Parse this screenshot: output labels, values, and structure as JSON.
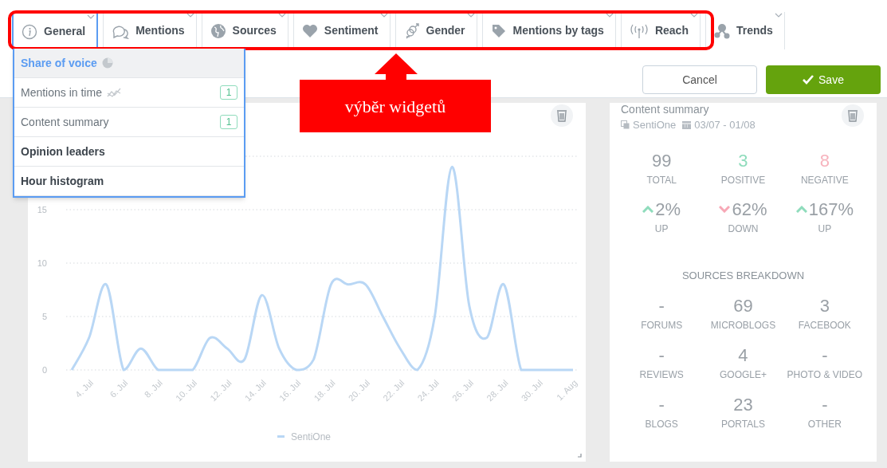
{
  "tabs": [
    {
      "label": "General",
      "kind": "info",
      "selected": true
    },
    {
      "label": "Mentions",
      "kind": "chat",
      "selected": false
    },
    {
      "label": "Sources",
      "kind": "globe",
      "selected": false
    },
    {
      "label": "Sentiment",
      "kind": "heart",
      "selected": false
    },
    {
      "label": "Gender",
      "kind": "gender",
      "selected": false
    },
    {
      "label": "Mentions by tags",
      "kind": "tag",
      "selected": false
    },
    {
      "label": "Reach",
      "kind": "antenna",
      "selected": false
    },
    {
      "label": "Trends",
      "kind": "people",
      "selected": false
    }
  ],
  "dropdown": {
    "items": [
      {
        "label": "Share of voice",
        "kind": "pie",
        "selected": true,
        "used": false
      },
      {
        "label": "Mentions in time",
        "kind": "line",
        "count": "1",
        "selected": false,
        "used": true
      },
      {
        "label": "Content summary",
        "count": "1",
        "selected": false,
        "used": true
      },
      {
        "label": "Opinion leaders",
        "selected": false,
        "used": false
      },
      {
        "label": "Hour histogram",
        "selected": false,
        "used": false
      }
    ]
  },
  "buttons": {
    "cancel": "Cancel",
    "save": "Save"
  },
  "annotation": {
    "text": "výběr widgetů"
  },
  "chart_widget": {
    "chart_data": {
      "type": "line",
      "categories": [
        null,
        "4. Jul",
        null,
        "6. Jul",
        null,
        "8. Jul",
        null,
        "10. Jul",
        null,
        "12. Jul",
        null,
        "14. Jul",
        null,
        "16. Jul",
        null,
        "18. Jul",
        null,
        "20. Jul",
        null,
        "22. Jul",
        null,
        "24. Jul",
        null,
        "26. Jul",
        null,
        "28. Jul",
        null,
        "30. Jul",
        null,
        "1. Aug"
      ],
      "ylim": [
        0,
        20
      ],
      "grid": true,
      "yticks": [
        0,
        5,
        10,
        15
      ],
      "series": [
        {
          "name": "SentiOne",
          "color": "#b9d7f5",
          "values": [
            0,
            3,
            8,
            0,
            2,
            0,
            0,
            0,
            3,
            2,
            1,
            7,
            2,
            0,
            1,
            8,
            8,
            8,
            5,
            2,
            0,
            5,
            19,
            6,
            3,
            8,
            0,
            0,
            0,
            0
          ]
        }
      ]
    }
  },
  "summary": {
    "title": "Content summary",
    "source": "SentiOne",
    "dates": "03/07 - 01/08",
    "totals": [
      {
        "value": "99",
        "label": "TOTAL",
        "color": "#9aa0a6"
      },
      {
        "value": "3",
        "label": "POSITIVE",
        "color": "#8fdcbc"
      },
      {
        "value": "8",
        "label": "NEGATIVE",
        "color": "#f7b3bd"
      }
    ],
    "trends": [
      {
        "value": "2%",
        "label": "UP",
        "kind": "up"
      },
      {
        "value": "62%",
        "label": "DOWN",
        "kind": "down"
      },
      {
        "value": "167%",
        "label": "UP",
        "kind": "up"
      }
    ],
    "breakdown_title": "SOURCES BREAKDOWN",
    "sources": [
      {
        "value": "-",
        "label": "FORUMS"
      },
      {
        "value": "69",
        "label": "MICROBLOGS"
      },
      {
        "value": "3",
        "label": "FACEBOOK"
      },
      {
        "value": "-",
        "label": "REVIEWS"
      },
      {
        "value": "4",
        "label": "GOOGLE+"
      },
      {
        "value": "-",
        "label": "PHOTO & VIDEO"
      },
      {
        "value": "-",
        "label": "BLOGS"
      },
      {
        "value": "23",
        "label": "PORTALS"
      },
      {
        "value": "-",
        "label": "OTHER"
      }
    ]
  }
}
